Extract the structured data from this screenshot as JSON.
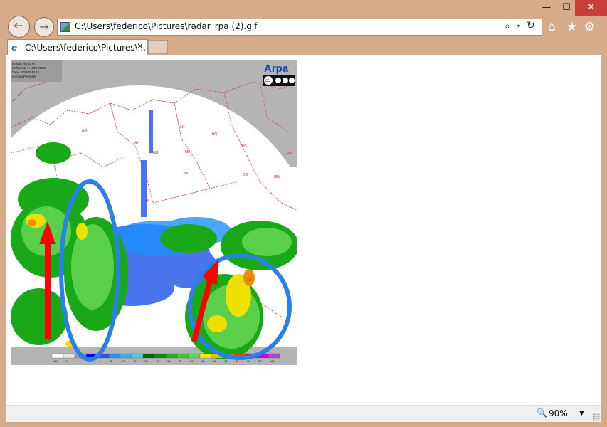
{
  "window": {
    "minimize": "—",
    "maximize": "☐",
    "close": "✕"
  },
  "nav": {
    "back": "←",
    "forward": "→"
  },
  "address": {
    "url": "C:\\Users\\federico\\Pictures\\radar_rpa (2).gif",
    "search": "⌕",
    "dropdown": "▾",
    "refresh": "↻"
  },
  "toolbar": {
    "home": "⌂",
    "favorites": "★",
    "settings": "⚙"
  },
  "tab": {
    "icon": "e",
    "title": "C:\\Users\\federico\\Pictures\\...",
    "close": "✕"
  },
  "status": {
    "zoom_icon": "🔍",
    "zoom": "90%",
    "zoom_drop": "▼"
  },
  "radar": {
    "header_lines": [
      "Mosaic Piemonte",
      "Reflectivity in UTM EBSE",
      "Date: 10/29/2014 19 ",
      "(c) Arpa Piemonte"
    ],
    "logo": "Arpa",
    "cc_badge": "cc",
    "region_labels": [
      "AO",
      "CO",
      "BG",
      "BS",
      "VR",
      "MI",
      "NO",
      "VA",
      "PV",
      "CR",
      "MN",
      "AL",
      "LU"
    ],
    "legend_labels": [
      "dBZ",
      "-5",
      "-4",
      "0",
      "4",
      "8",
      "12",
      "16",
      "20",
      "24",
      "28",
      "32",
      "36",
      "40",
      "44",
      "48",
      "52",
      "56",
      "60",
      ">64"
    ],
    "legend_colors": [
      "#ffffff",
      "#e6e6e6",
      "#9b9b9b",
      "#0000cd",
      "#3050e8",
      "#1e90ff",
      "#3ab0f0",
      "#48d1e0",
      "#006400",
      "#0a8a0a",
      "#22b022",
      "#34c834",
      "#60d850",
      "#f0f000",
      "#f0c000",
      "#f08000",
      "#f04000",
      "#d00000",
      "#d000d0",
      "#b040e0"
    ],
    "colors": {
      "ellipse": "#2a7fe8",
      "arrow": "#ff0000",
      "grey": "#b4b4b4"
    }
  }
}
